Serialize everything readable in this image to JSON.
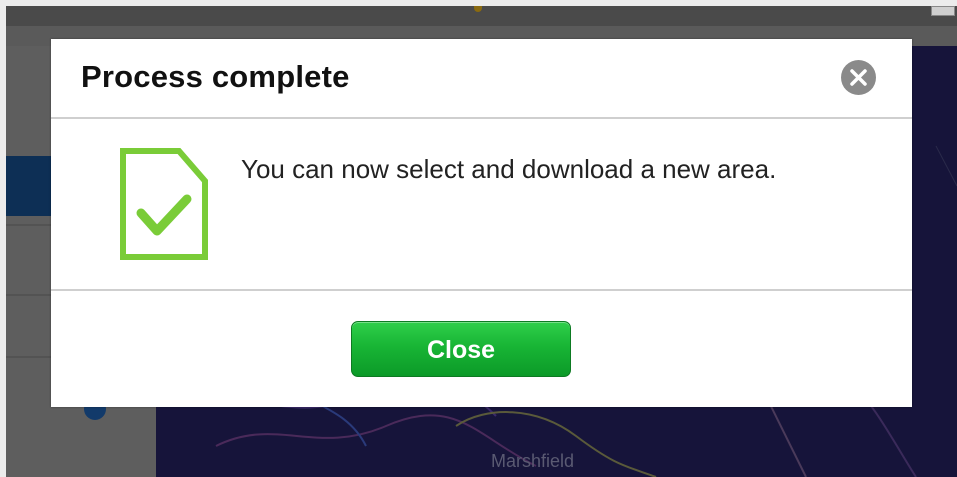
{
  "dialog": {
    "title": "Process complete",
    "message": "You can now select and download a new area.",
    "close_button_label": "Close",
    "close_icon": "close-x-icon",
    "status_icon": "document-check-icon"
  },
  "background": {
    "map_label": "Marshfield"
  },
  "colors": {
    "accent_green": "#7acc38",
    "button_green": "#18b535",
    "close_icon_gray": "#8a8a8a",
    "map_background": "#16143a"
  }
}
